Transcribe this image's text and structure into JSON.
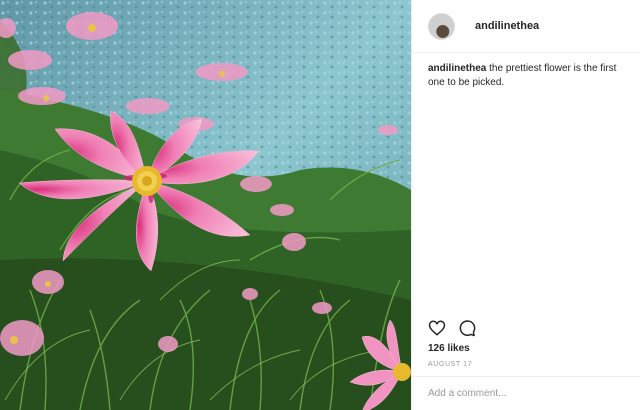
{
  "post": {
    "username": "andilinethea",
    "caption_user": "andilinethea",
    "caption_text": "the prettiest flower is the first one to be picked.",
    "likes": "126 likes",
    "date": "AUGUST 17"
  },
  "comment": {
    "placeholder": "Add a comment..."
  },
  "icons": {
    "like": "heart-icon",
    "comment": "speech-bubble-icon"
  },
  "colors": {
    "text": "#262626",
    "muted": "#999999",
    "border": "#efefef",
    "flower_pink": "#f28cc0",
    "flower_center": "#e8b92e",
    "gravel": "#7fb8c4",
    "foliage": "#3f7a32"
  }
}
